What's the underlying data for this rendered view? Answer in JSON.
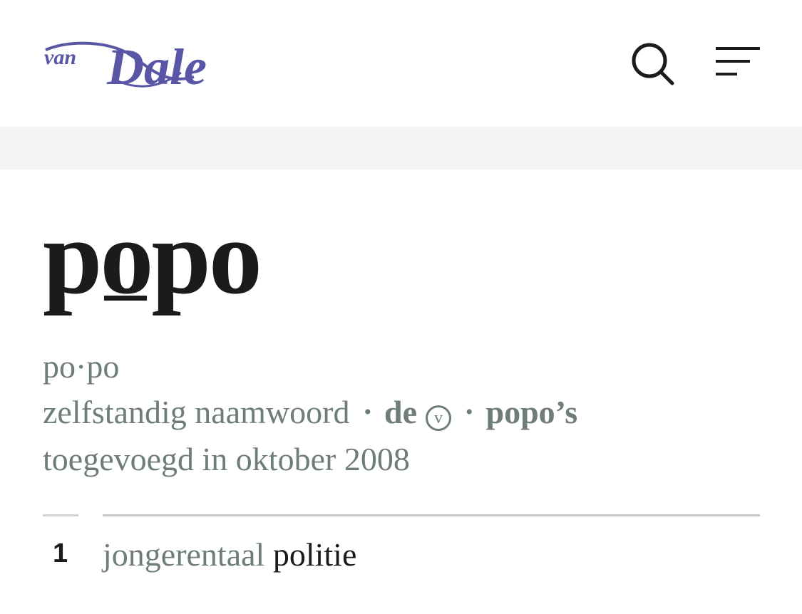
{
  "header": {
    "logo_text": "van Dale",
    "logo_color": "#5a56a6",
    "search_icon": "search-icon",
    "menu_icon": "menu-icon"
  },
  "entry": {
    "headword_before": "p",
    "headword_stressed": "o",
    "headword_after": "po",
    "syllables": "po·po",
    "part_of_speech": "zelfstandig naamwoord",
    "separator": "•",
    "article": "de",
    "article_toggle_symbol": "v",
    "plural": "popo’s",
    "added": "toegevoegd in oktober 2008"
  },
  "senses": [
    {
      "number": "1",
      "label": "jongerentaal",
      "definition": "politie"
    }
  ],
  "colors": {
    "text": "#1b1b1b",
    "meta": "#6e7d75",
    "band": "#f4f4f6"
  }
}
